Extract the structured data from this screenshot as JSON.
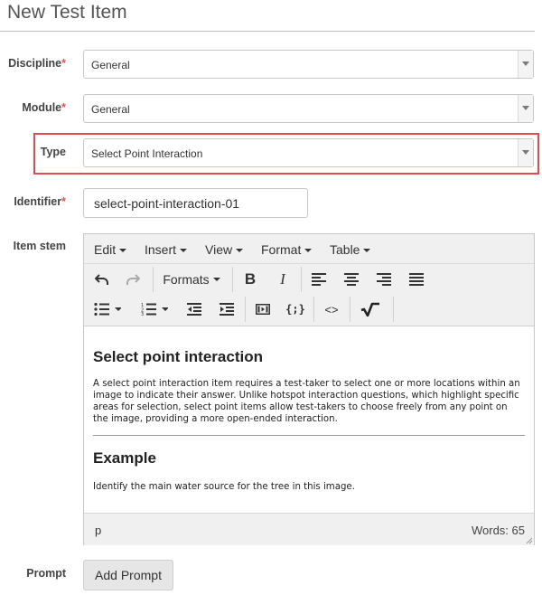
{
  "page": {
    "title": "New Test Item"
  },
  "form": {
    "discipline": {
      "label": "Discipline",
      "required_mark": "*",
      "value": "General"
    },
    "module": {
      "label": "Module",
      "required_mark": "*",
      "value": "General"
    },
    "type": {
      "label": "Type",
      "value": "Select Point Interaction"
    },
    "identifier": {
      "label": "Identifier",
      "required_mark": "*",
      "value": "select-point-interaction-01"
    },
    "item_stem": {
      "label": "Item stem"
    },
    "prompt": {
      "label": "Prompt",
      "button": "Add Prompt"
    }
  },
  "editor": {
    "menus": [
      "Edit",
      "Insert",
      "View",
      "Format",
      "Table"
    ],
    "formats_label": "Formats",
    "toolbar_icons": [
      "undo-icon",
      "redo-icon",
      "bold-icon",
      "italic-icon",
      "align-left-icon",
      "align-center-icon",
      "align-right-icon",
      "align-justify-icon",
      "bullet-list-icon",
      "numbered-list-icon",
      "outdent-icon",
      "indent-icon",
      "media-icon",
      "template-icon",
      "code-icon",
      "math-icon"
    ],
    "content": {
      "heading": "Select point interaction",
      "paragraph": "A select point interaction item requires a test-taker to select one or more locations within an image to indicate their answer. Unlike hotspot interaction questions, which highlight specific areas for selection, select point items allow test-takers to choose freely from any point on the image, providing a more open-ended interaction.",
      "heading2": "Example",
      "paragraph2": "Identify the main water source for the tree in this image."
    },
    "status": {
      "path": "p",
      "words": "Words: 65"
    }
  },
  "colors": {
    "highlight": "#e04b4b",
    "required": "#d9534f"
  }
}
